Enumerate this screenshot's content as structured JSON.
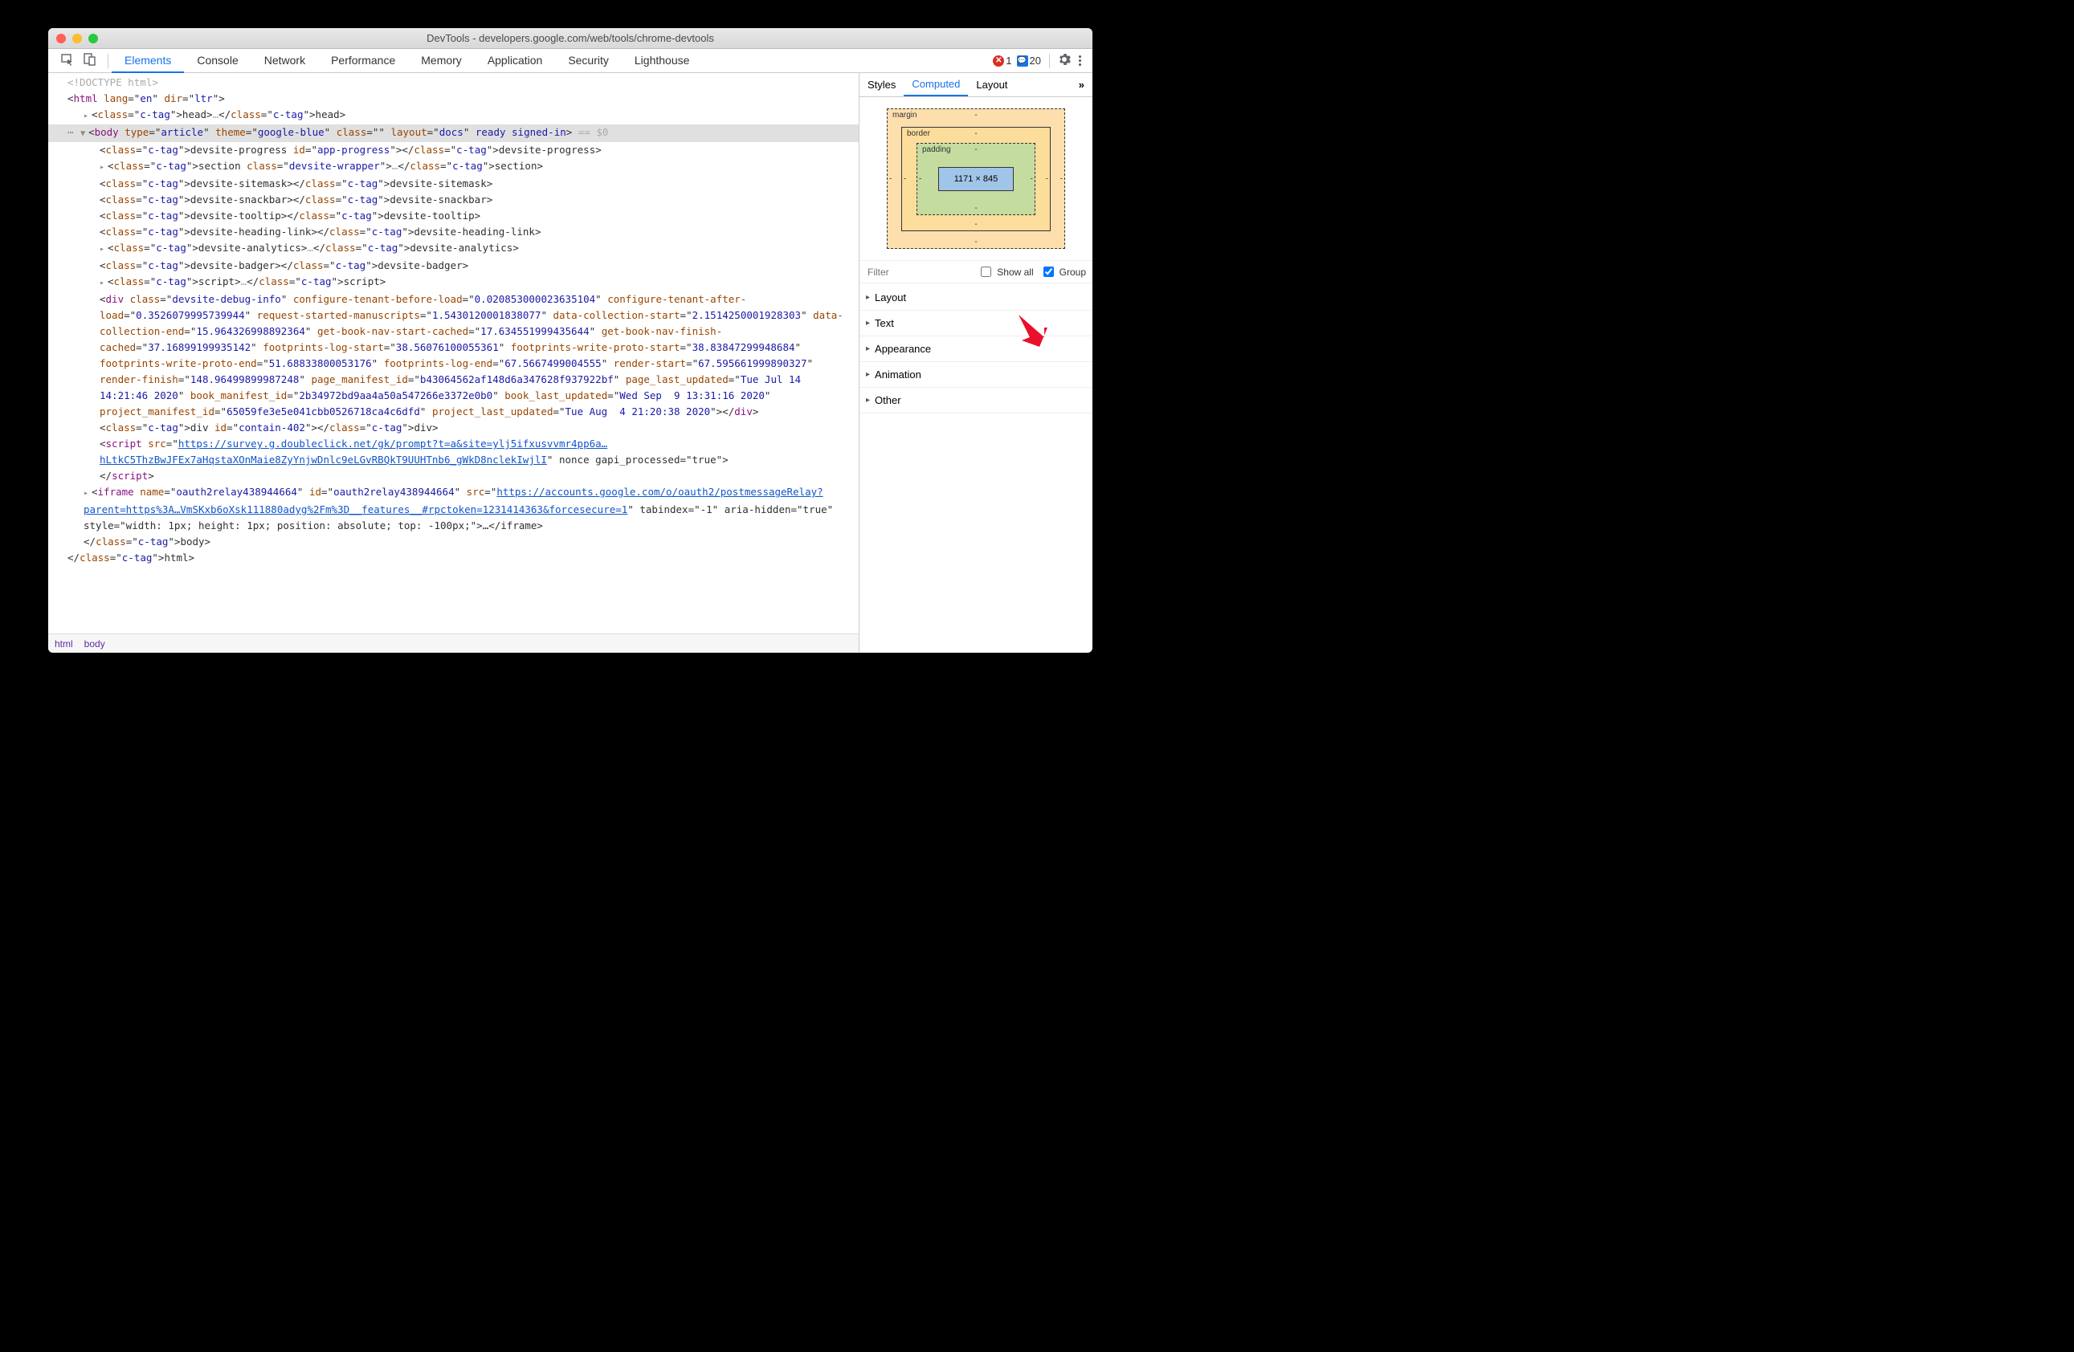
{
  "titlebar": "DevTools - developers.google.com/web/tools/chrome-devtools",
  "tabs": [
    "Elements",
    "Console",
    "Network",
    "Performance",
    "Memory",
    "Application",
    "Security",
    "Lighthouse"
  ],
  "activeTab": "Elements",
  "errorCount": "1",
  "messageCount": "20",
  "breadcrumbs": [
    "html",
    "body"
  ],
  "side": {
    "tabs": [
      "Styles",
      "Computed",
      "Layout"
    ],
    "active": "Computed",
    "more": "»",
    "bm": {
      "margin": "margin",
      "border": "border",
      "padding": "padding",
      "dim": "1171 × 845"
    },
    "filter": {
      "placeholder": "Filter",
      "showAll": "Show all",
      "group": "Group"
    },
    "groups": [
      "Layout",
      "Text",
      "Appearance",
      "Animation",
      "Other"
    ]
  },
  "dom": {
    "doctype": "<!DOCTYPE html>",
    "html_open": {
      "tag": "html",
      "attrs": [
        [
          "lang",
          "en"
        ],
        [
          "dir",
          "ltr"
        ]
      ]
    },
    "head": "<head>…</head>",
    "body_line": {
      "tag": "body",
      "attrs": [
        [
          "type",
          "article"
        ],
        [
          "theme",
          "google-blue"
        ],
        [
          "class",
          ""
        ],
        [
          "layout",
          "docs"
        ],
        [
          "",
          "ready signed-in"
        ]
      ],
      "suffix": " == $0"
    },
    "lines": [
      "<devsite-progress id=\"app-progress\"></devsite-progress>",
      "▸ <section class=\"devsite-wrapper\">…</section>",
      "<devsite-sitemask></devsite-sitemask>",
      "<devsite-snackbar></devsite-snackbar>",
      "<devsite-tooltip></devsite-tooltip>",
      "<devsite-heading-link></devsite-heading-link>",
      "▸ <devsite-analytics>…</devsite-analytics>",
      "<devsite-badger></devsite-badger>",
      "▸ <script>…</script>"
    ],
    "divwrap": {
      "attrs": [
        [
          "class",
          "devsite-debug-info"
        ],
        [
          "configure-tenant-before-load",
          "0.020853000023635104"
        ],
        [
          "configure-tenant-after-load",
          "0.3526079995739944"
        ],
        [
          "request-started-manuscripts",
          "1.5430120001838077"
        ],
        [
          "data-collection-start",
          "2.1514250001928303"
        ],
        [
          "data-collection-end",
          "15.964326998892364"
        ],
        [
          "get-book-nav-start-cached",
          "17.634551999435644"
        ],
        [
          "get-book-nav-finish-cached",
          "37.16899199935142"
        ],
        [
          "footprints-log-start",
          "38.56076100055361"
        ],
        [
          "footprints-write-proto-start",
          "38.83847299948684"
        ],
        [
          "footprints-write-proto-end",
          "51.68833800053176"
        ],
        [
          "footprints-log-end",
          "67.5667499004555"
        ],
        [
          "render-start",
          "67.595661999890327"
        ],
        [
          "render-finish",
          "148.96499899987248"
        ],
        [
          "page_manifest_id",
          "b43064562af148d6a347628f937922bf"
        ],
        [
          "page_last_updated",
          "Tue Jul 14 14:21:46 2020"
        ],
        [
          "book_manifest_id",
          "2b34972bd9aa4a50a547266e3372e0b0"
        ],
        [
          "book_last_updated",
          "Wed Sep  9 13:31:16 2020"
        ],
        [
          "project_manifest_id",
          "65059fe3e5e041cbb0526718ca4c6dfd"
        ],
        [
          "project_last_updated",
          "Tue Aug  4 21:20:38 2020"
        ]
      ]
    },
    "contain402": "<div id=\"contain-402\"></div>",
    "script_src": {
      "url": "https://survey.g.doubleclick.net/gk/prompt?t=a&site=ylj5ifxusvvmr4pp6a…hLtkC5ThzBwJFEx7aHqstaXOnMaie8ZyYnjwDnlc9eLGvRBQkT9UUHTnb6_gWkD8nclekIwjlI",
      "tail": " nonce gapi_processed=\"true\">"
    },
    "script_close": "</script>",
    "iframe": {
      "name": "oauth2relay438944664",
      "id": "oauth2relay438944664",
      "url": "https://accounts.google.com/o/oauth2/postmessageRelay?parent=https%3A…VmSKxb6oXsk111880adyg%2Fm%3D__features__#rpctoken=1231414363&forcesecure=1",
      "tail": " tabindex=\"-1\" aria-hidden=\"true\" style=\"width: 1px; height: 1px; position: absolute; top: -100px;\">…</iframe>"
    },
    "body_close": "</body>",
    "html_close": "</html>"
  }
}
